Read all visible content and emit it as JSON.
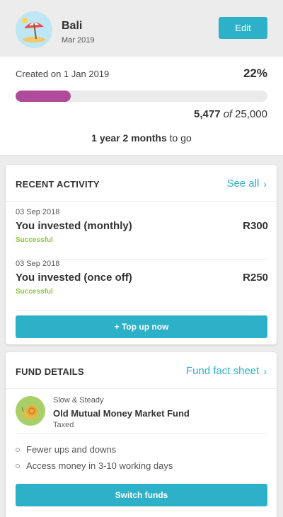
{
  "goal": {
    "name": "Bali",
    "date": "Mar 2019",
    "edit_label": "Edit",
    "avatar_icon": "beach-umbrella-icon"
  },
  "progress": {
    "created": "Created on 1 Jan 2019",
    "percent_label": "22%",
    "fraction": 0.22,
    "current": "5,477",
    "of": "of",
    "target": "25,000",
    "to_go_bold": "1 year 2 months",
    "to_go_rest": " to go",
    "bar_color": "#b04a9a"
  },
  "activity": {
    "title": "RECENT ACTIVITY",
    "see_all": "See all",
    "items": [
      {
        "date": "03 Sep 2018",
        "desc": "You invested (monthly)",
        "status": "Successful",
        "amount": "R300"
      },
      {
        "date": "03 Sep 2018",
        "desc": "You invested (once off)",
        "status": "Successful",
        "amount": "R250"
      }
    ],
    "top_up_label": "+ Top up now"
  },
  "fund": {
    "title": "FUND DETAILS",
    "fact_sheet": "Fund fact sheet",
    "category": "Slow & Steady",
    "name": "Old Mutual Money Market Fund",
    "tax": "Taxed",
    "icon": "snail-icon",
    "bullets": [
      "Fewer ups and downs",
      "Access money in 3-10 working days"
    ],
    "switch_label": "Switch funds"
  },
  "colors": {
    "accent": "#2db1c9",
    "success": "#8cc63f",
    "progress": "#b04a9a"
  }
}
